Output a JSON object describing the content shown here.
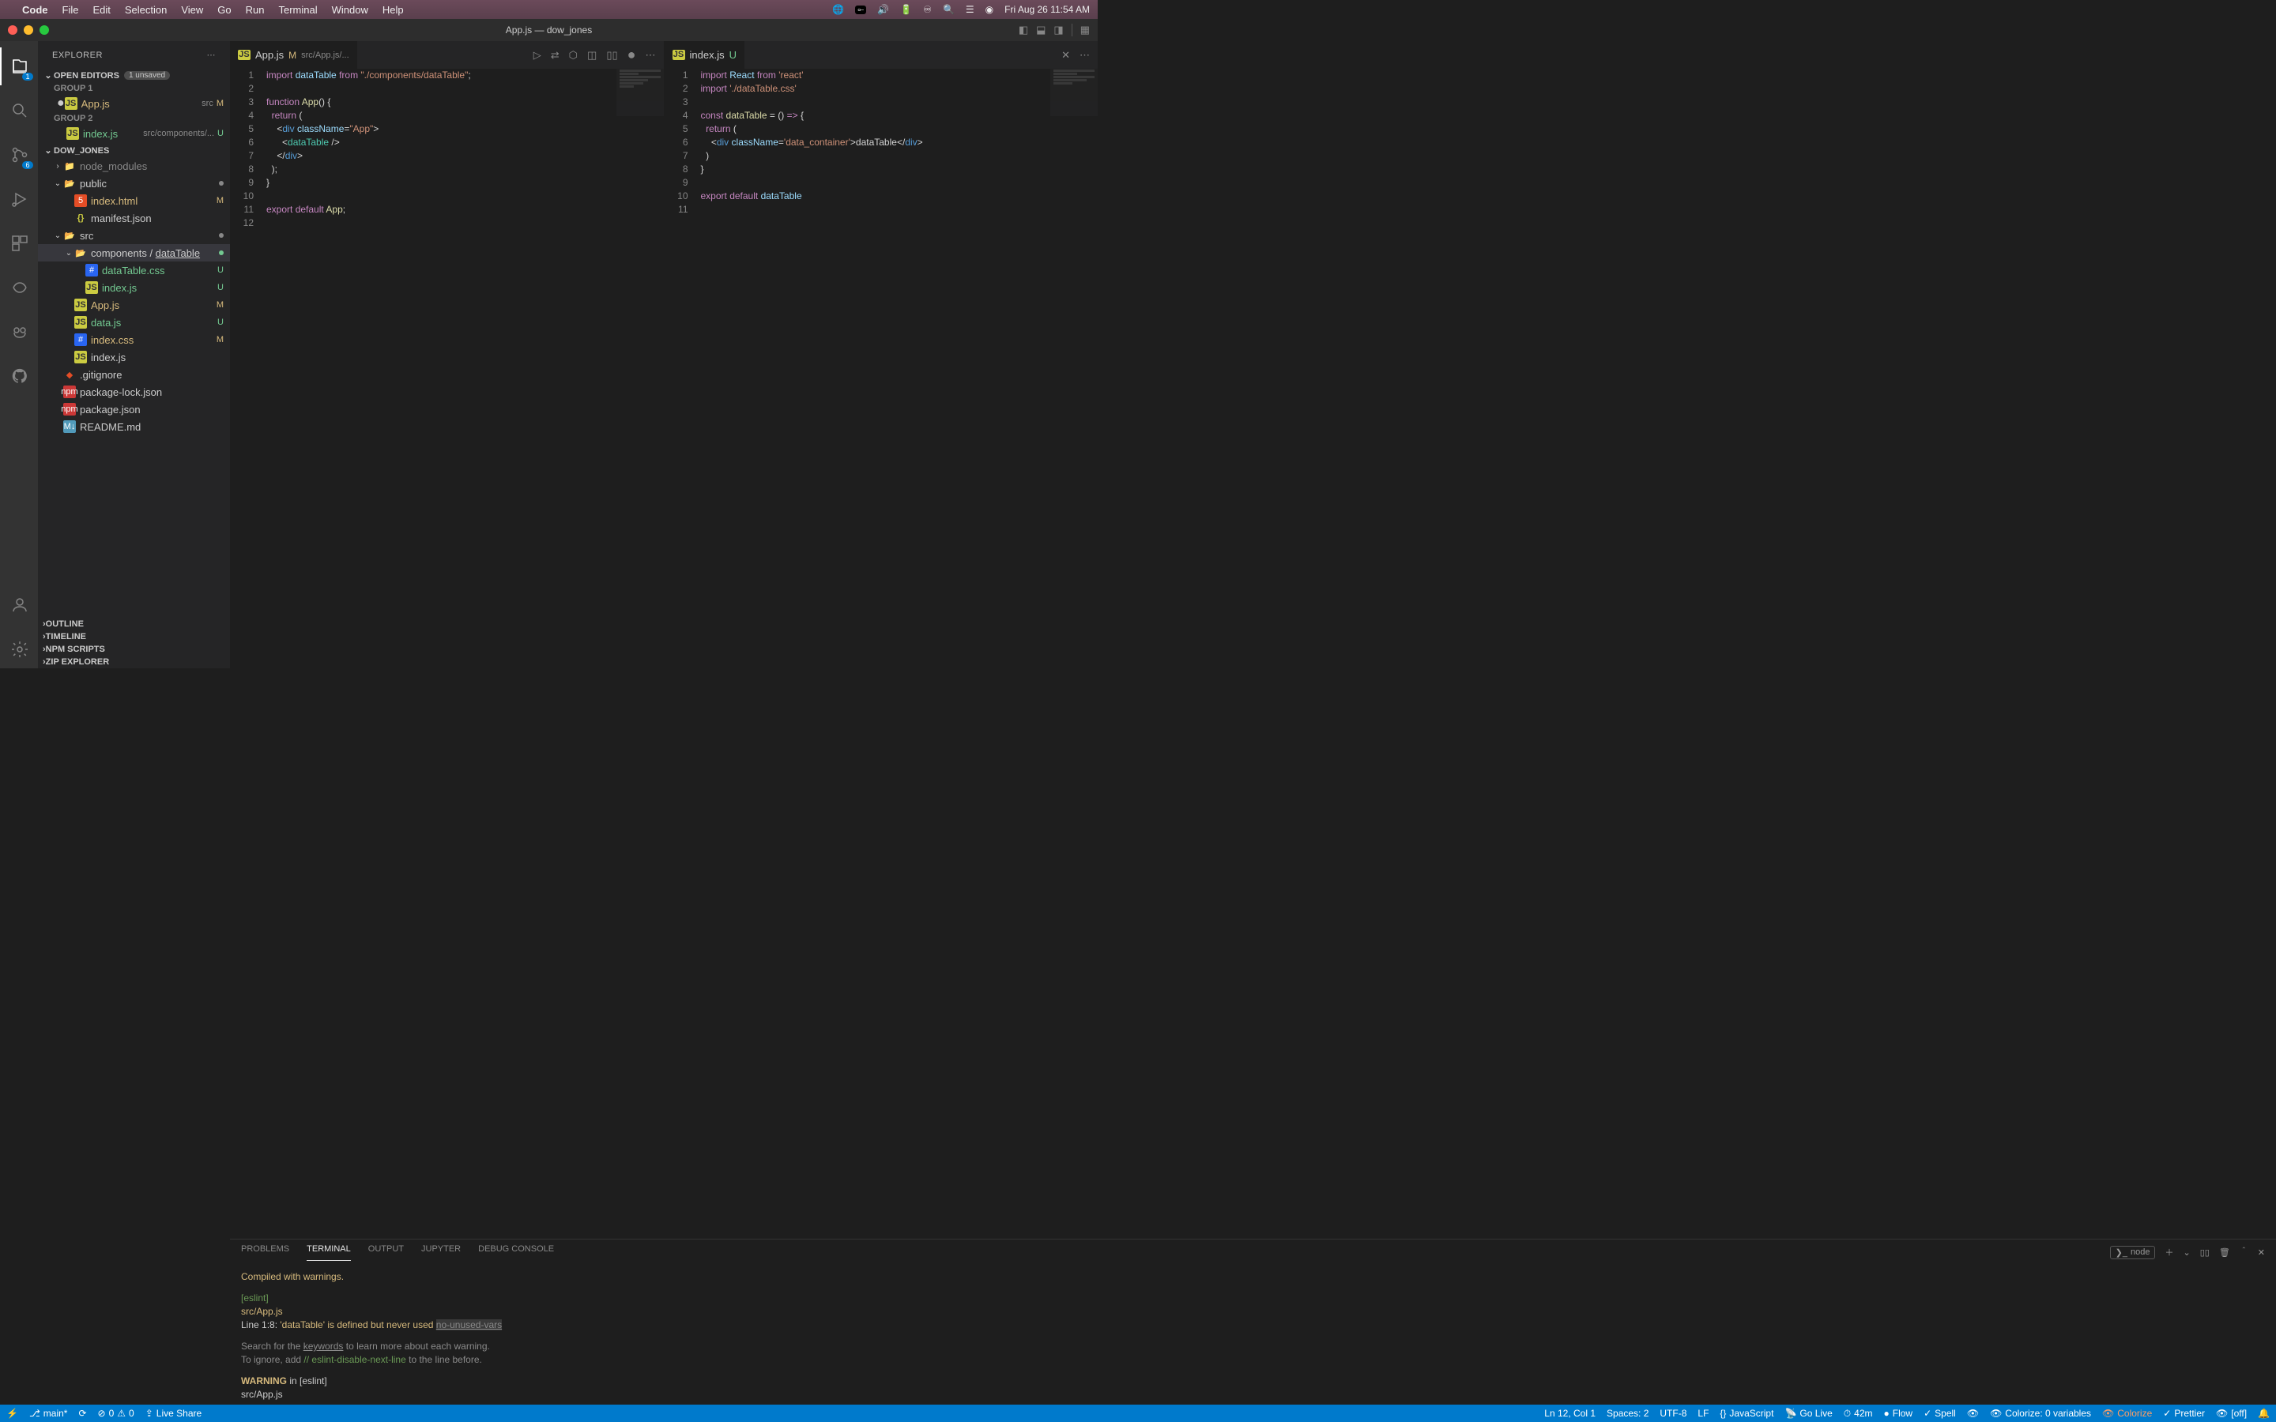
{
  "menubar": {
    "app": "Code",
    "items": [
      "File",
      "Edit",
      "Selection",
      "View",
      "Go",
      "Run",
      "Terminal",
      "Window",
      "Help"
    ],
    "clock": "Fri Aug 26  11:54 AM"
  },
  "title": "App.js — dow_jones",
  "activity": {
    "scm_badge": "6",
    "explorer_badge": "1"
  },
  "explorer": {
    "title": "EXPLORER",
    "open_editors": "OPEN EDITORS",
    "unsaved": "1 unsaved",
    "group1": "GROUP 1",
    "group2": "GROUP 2",
    "project": "DOW_JONES",
    "oe1": {
      "name": "App.js",
      "path": "src",
      "decor": "M"
    },
    "oe2": {
      "name": "index.js",
      "path": "src/components/...",
      "decor": "U"
    },
    "tree": {
      "node_modules": "node_modules",
      "public": "public",
      "index_html": "index.html",
      "manifest": "manifest.json",
      "src": "src",
      "components": "components",
      "dataTable": "dataTable",
      "dt_css": "dataTable.css",
      "dt_idx": "index.js",
      "app": "App.js",
      "data": "data.js",
      "idx_css": "index.css",
      "idx_js": "index.js",
      "gitignore": ".gitignore",
      "pkglock": "package-lock.json",
      "pkg": "package.json",
      "readme": "README.md"
    },
    "bottom": {
      "outline": "OUTLINE",
      "timeline": "TIMELINE",
      "npm": "NPM SCRIPTS",
      "zip": "ZIP EXPLORER"
    }
  },
  "tabs": {
    "left": {
      "name": "App.js",
      "decor": "M",
      "sub": "src/App.js/..."
    },
    "right": {
      "name": "index.js",
      "decor": "U"
    }
  },
  "code_left": {
    "lines": [
      [
        {
          "t": "kw",
          "s": "import"
        },
        {
          "t": "pn",
          "s": " "
        },
        {
          "t": "var",
          "s": "dataTable"
        },
        {
          "t": "pn",
          "s": " "
        },
        {
          "t": "kw",
          "s": "from"
        },
        {
          "t": "pn",
          "s": " "
        },
        {
          "t": "str",
          "s": "\"./components/dataTable\""
        },
        {
          "t": "pn",
          "s": ";"
        }
      ],
      [],
      [
        {
          "t": "kw",
          "s": "function"
        },
        {
          "t": "pn",
          "s": " "
        },
        {
          "t": "fn",
          "s": "App"
        },
        {
          "t": "pn",
          "s": "() {"
        }
      ],
      [
        {
          "t": "pn",
          "s": "  "
        },
        {
          "t": "kw",
          "s": "return"
        },
        {
          "t": "pn",
          "s": " ("
        }
      ],
      [
        {
          "t": "pn",
          "s": "    <"
        },
        {
          "t": "tag",
          "s": "div"
        },
        {
          "t": "pn",
          "s": " "
        },
        {
          "t": "attr",
          "s": "className"
        },
        {
          "t": "pn",
          "s": "="
        },
        {
          "t": "str",
          "s": "\"App\""
        },
        {
          "t": "pn",
          "s": ">"
        }
      ],
      [
        {
          "t": "pn",
          "s": "      <"
        },
        {
          "t": "type",
          "s": "dataTable"
        },
        {
          "t": "pn",
          "s": " />"
        }
      ],
      [
        {
          "t": "pn",
          "s": "    </"
        },
        {
          "t": "tag",
          "s": "div"
        },
        {
          "t": "pn",
          "s": ">"
        }
      ],
      [
        {
          "t": "pn",
          "s": "  );"
        }
      ],
      [
        {
          "t": "pn",
          "s": "}"
        }
      ],
      [],
      [
        {
          "t": "kw",
          "s": "export"
        },
        {
          "t": "pn",
          "s": " "
        },
        {
          "t": "kw",
          "s": "default"
        },
        {
          "t": "pn",
          "s": " "
        },
        {
          "t": "fn",
          "s": "App"
        },
        {
          "t": "pn",
          "s": ";"
        }
      ],
      []
    ]
  },
  "code_right": {
    "lines": [
      [
        {
          "t": "kw",
          "s": "import"
        },
        {
          "t": "pn",
          "s": " "
        },
        {
          "t": "var",
          "s": "React"
        },
        {
          "t": "pn",
          "s": " "
        },
        {
          "t": "kw",
          "s": "from"
        },
        {
          "t": "pn",
          "s": " "
        },
        {
          "t": "str",
          "s": "'react'"
        }
      ],
      [
        {
          "t": "kw",
          "s": "import"
        },
        {
          "t": "pn",
          "s": " "
        },
        {
          "t": "str",
          "s": "'./dataTable.css'"
        }
      ],
      [],
      [
        {
          "t": "kw",
          "s": "const"
        },
        {
          "t": "pn",
          "s": " "
        },
        {
          "t": "fn",
          "s": "dataTable"
        },
        {
          "t": "pn",
          "s": " = () "
        },
        {
          "t": "kw",
          "s": "=>"
        },
        {
          "t": "pn",
          "s": " {"
        }
      ],
      [
        {
          "t": "pn",
          "s": "  "
        },
        {
          "t": "kw",
          "s": "return"
        },
        {
          "t": "pn",
          "s": " ("
        }
      ],
      [
        {
          "t": "pn",
          "s": "    <"
        },
        {
          "t": "tag",
          "s": "div"
        },
        {
          "t": "pn",
          "s": " "
        },
        {
          "t": "attr",
          "s": "className"
        },
        {
          "t": "pn",
          "s": "="
        },
        {
          "t": "str",
          "s": "'data_container'"
        },
        {
          "t": "pn",
          "s": ">"
        },
        {
          "t": "pn",
          "s": "dataTable</"
        },
        {
          "t": "tag",
          "s": "div"
        },
        {
          "t": "pn",
          "s": ">"
        }
      ],
      [
        {
          "t": "pn",
          "s": "  )"
        }
      ],
      [
        {
          "t": "pn",
          "s": "}"
        }
      ],
      [],
      [
        {
          "t": "kw",
          "s": "export"
        },
        {
          "t": "pn",
          "s": " "
        },
        {
          "t": "kw",
          "s": "default"
        },
        {
          "t": "pn",
          "s": " "
        },
        {
          "t": "var",
          "s": "dataTable"
        }
      ],
      []
    ]
  },
  "panel": {
    "tabs": {
      "problems": "PROBLEMS",
      "terminal": "TERMINAL",
      "output": "OUTPUT",
      "jupyter": "JUPYTER",
      "debug": "DEBUG CONSOLE"
    },
    "term_sel": "node",
    "body": {
      "l1": "Compiled with warnings.",
      "l2": "[eslint]",
      "l3": "src/App.js",
      "l4a": "  Line 1:8:  ",
      "l4b": "'dataTable' is defined but never used  ",
      "l4c": "no-unused-vars",
      "l5a": "Search for the ",
      "l5b": "keywords",
      "l5c": " to learn more about each warning.",
      "l6a": "To ignore, add ",
      "l6b": "// eslint-disable-next-line",
      "l6c": " to the line before.",
      "l7a": "WARNING",
      "l7b": " in ",
      "l7c": "[eslint]",
      "l8": "src/App.js"
    }
  },
  "statusbar": {
    "branch": "main*",
    "sync": "",
    "errors": "0",
    "warnings": "0",
    "live": "Live Share",
    "ln": "Ln 12, Col 1",
    "spaces": "Spaces: 2",
    "enc": "UTF-8",
    "eol": "LF",
    "lang": "JavaScript",
    "golive": "Go Live",
    "time": "42m",
    "flow": "Flow",
    "spell": "Spell",
    "colorize": "Colorize: 0 variables",
    "colorize2": "Colorize",
    "prettier": "Prettier",
    "off": "[off]"
  }
}
